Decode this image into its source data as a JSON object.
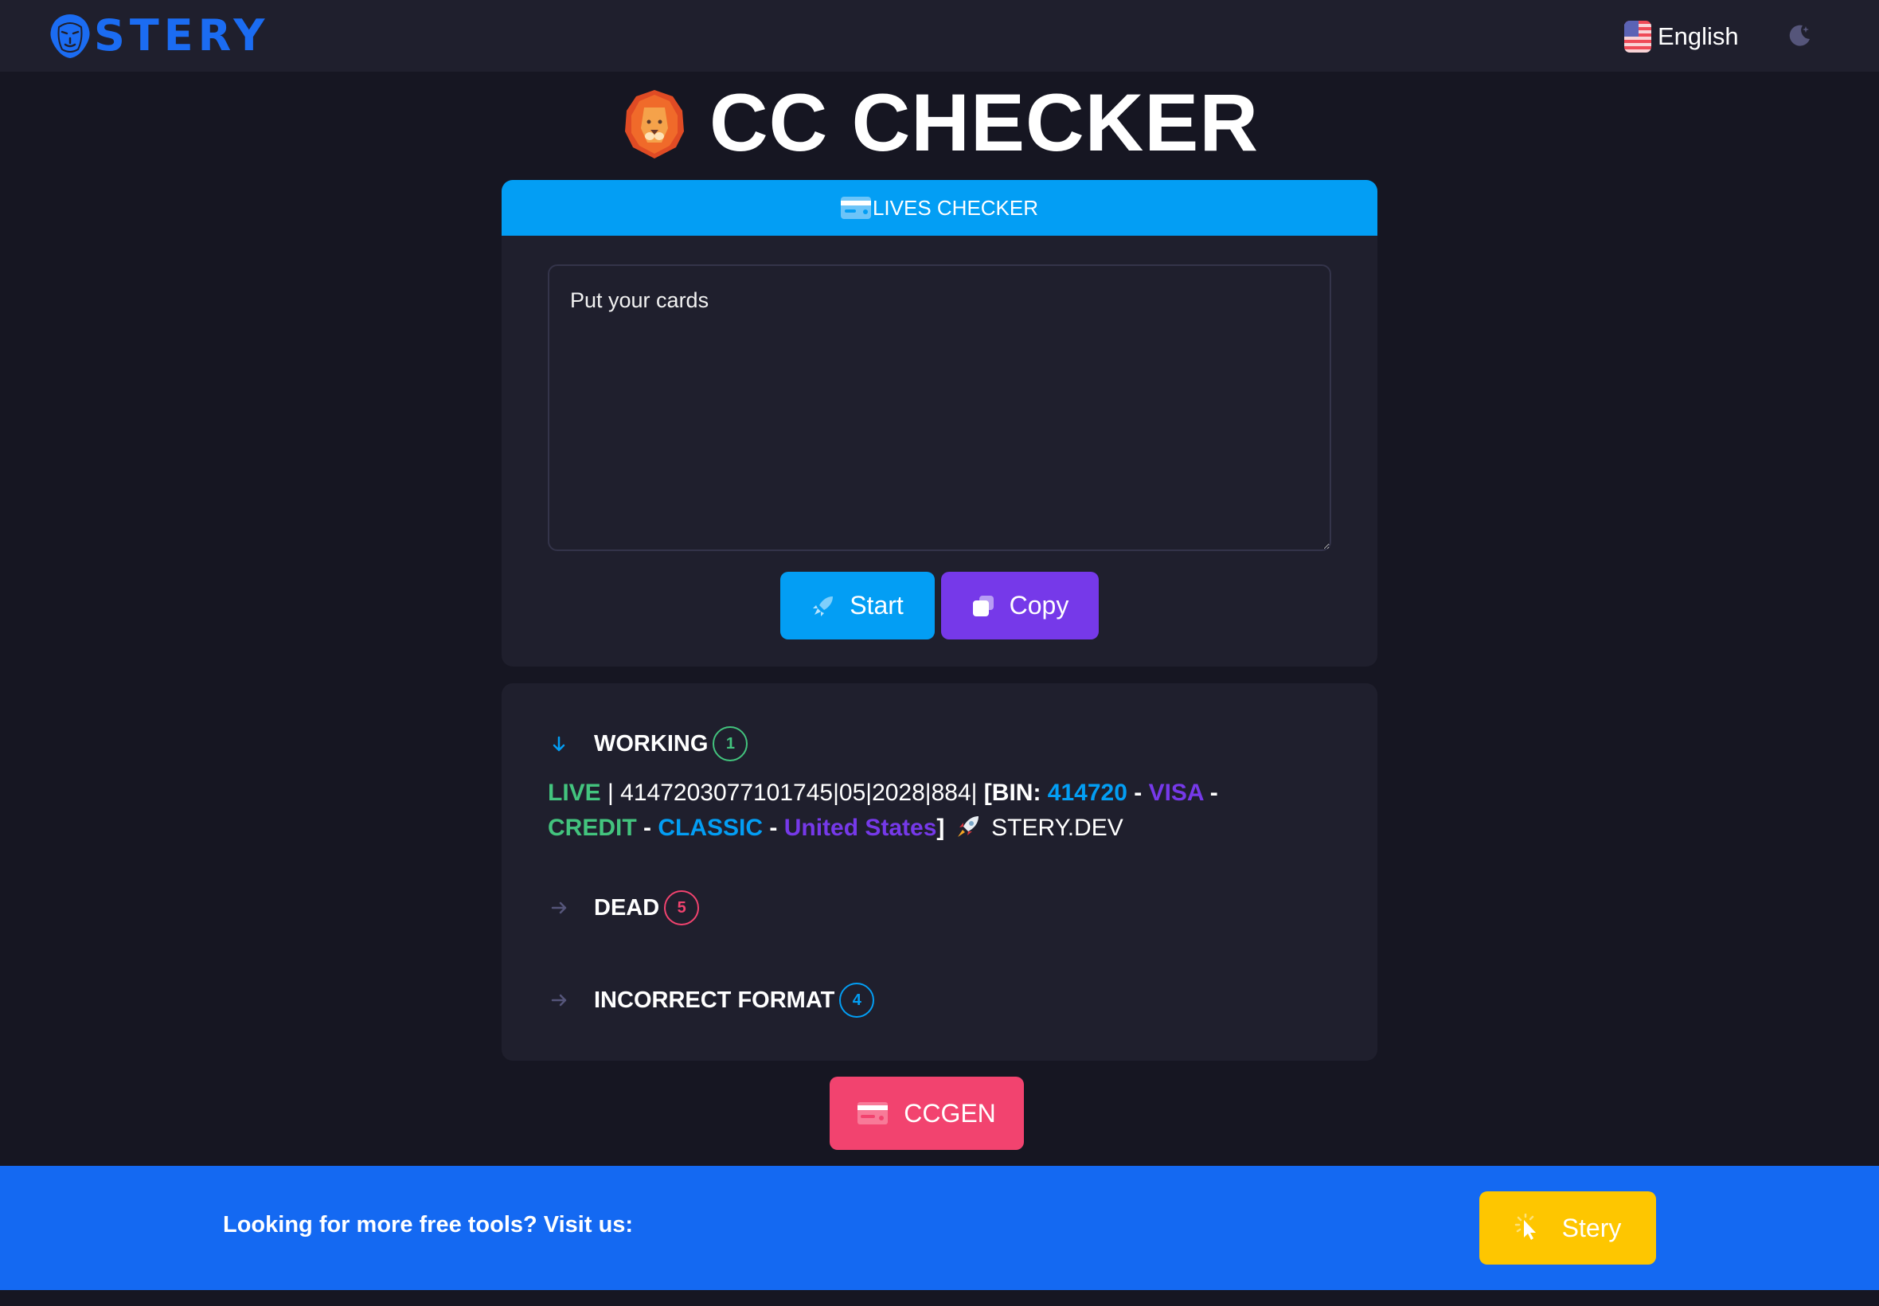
{
  "header": {
    "brand": "STERY",
    "language": "English",
    "theme_toggle_icon": "moon-icon"
  },
  "title": {
    "icon": "lion-emoji",
    "text": "CC CHECKER"
  },
  "checker": {
    "header_label": "LIVES CHECKER",
    "input_placeholder": "Put your cards",
    "input_value": "",
    "start_label": "Start",
    "copy_label": "Copy"
  },
  "results": {
    "working": {
      "label": "WORKING",
      "count": "1",
      "expanded": true,
      "color": "#43c47e"
    },
    "entry": {
      "status": "LIVE",
      "sep1": " | ",
      "card": "4147203077101745|05|2028|884|",
      "bin_prefix": " [BIN: ",
      "bin": "414720",
      "dash1": " - ",
      "brand": "VISA",
      "dash2": " - ",
      "type": "CREDIT",
      "dash3": " - ",
      "level": "CLASSIC",
      "dash4": " - ",
      "country": "United States",
      "close": "]",
      "tag": "STERY.DEV"
    },
    "dead": {
      "label": "DEAD",
      "count": "5",
      "expanded": false,
      "color": "#f2436f"
    },
    "incorrect": {
      "label": "INCORRECT FORMAT",
      "count": "4",
      "expanded": false,
      "color": "#039ef4"
    }
  },
  "ccgen_label": "CCGEN",
  "footer": {
    "text": "Looking for more free tools? Visit us:",
    "button_label": "Stery"
  },
  "colors": {
    "accent_blue": "#039ef4",
    "accent_purple": "#7639e9",
    "accent_pink": "#f2436f",
    "brand_blue": "#1469f2",
    "accent_yellow": "#fec600"
  }
}
